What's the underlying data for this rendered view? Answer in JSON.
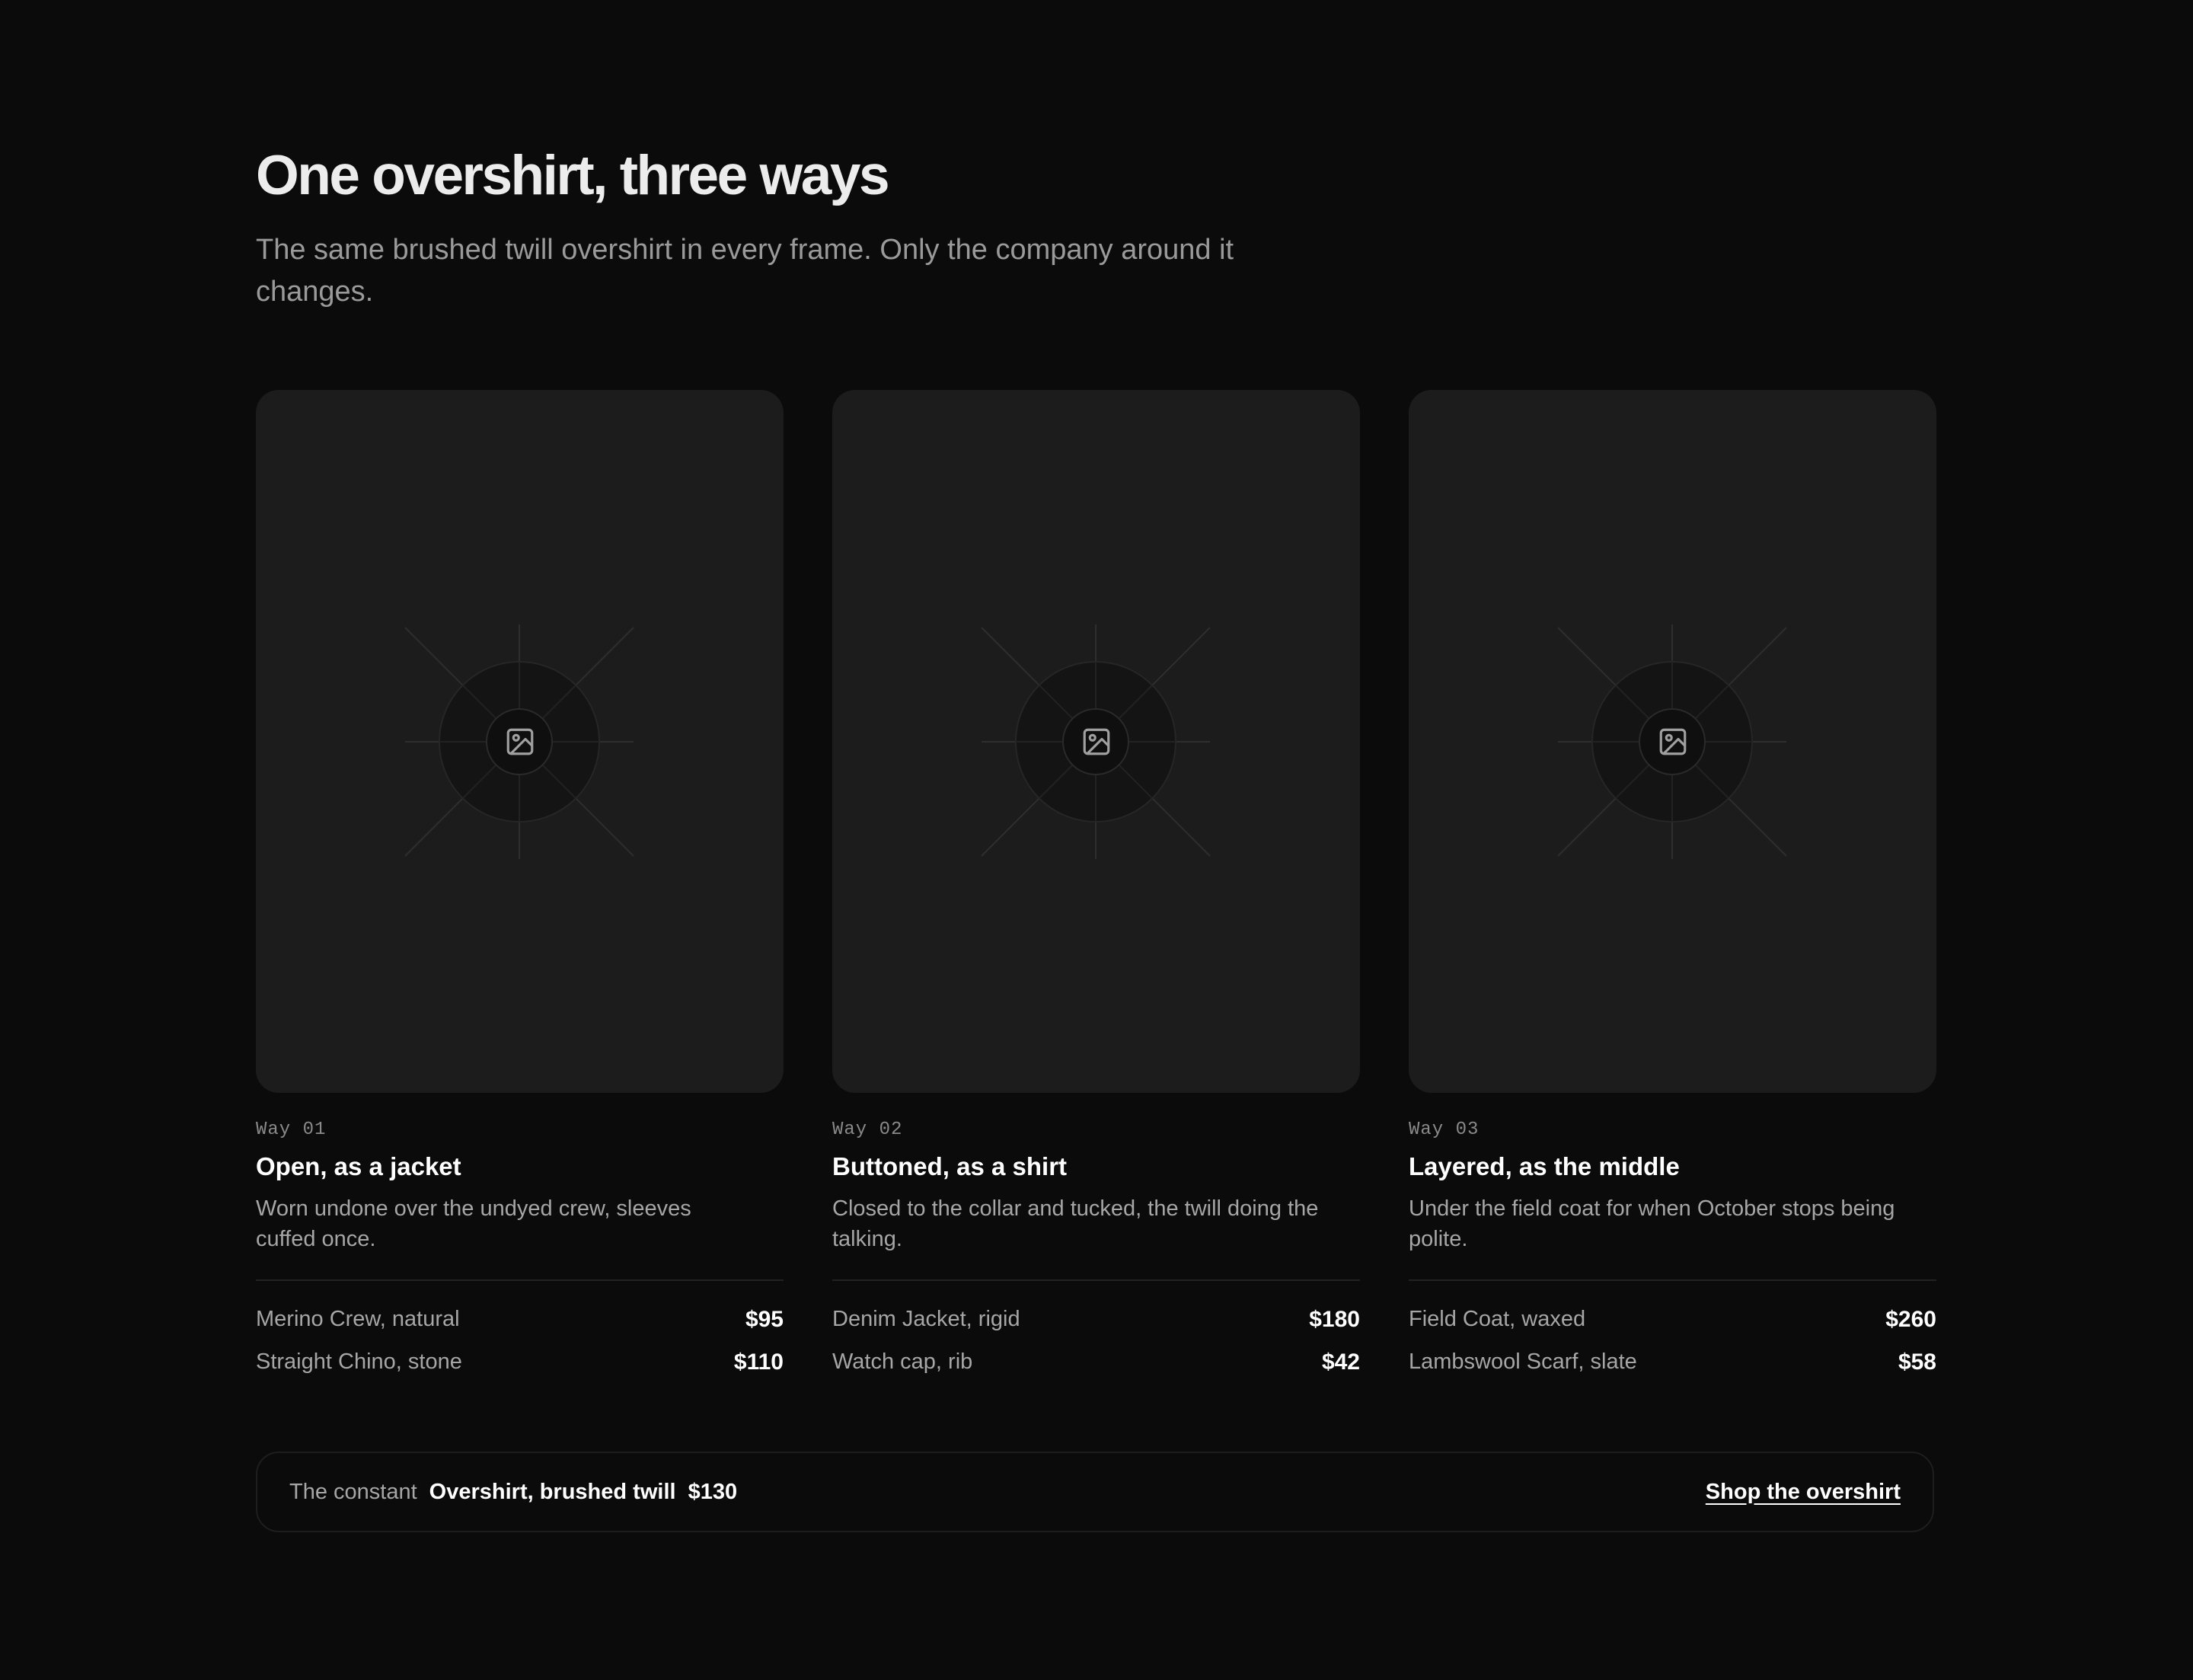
{
  "header": {
    "title": "One overshirt, three ways",
    "subtitle": "The same brushed twill overshirt in every frame. Only the company around it changes."
  },
  "cards": [
    {
      "way": "Way 01",
      "title": "Open, as a jacket",
      "description": "Worn undone over the undyed crew, sleeves cuffed once.",
      "image_icon": "image-placeholder-icon",
      "items": [
        {
          "name": "Merino Crew, natural",
          "price": "$95"
        },
        {
          "name": "Straight Chino, stone",
          "price": "$110"
        }
      ]
    },
    {
      "way": "Way 02",
      "title": "Buttoned, as a shirt",
      "description": "Closed to the collar and tucked, the twill doing the talking.",
      "image_icon": "image-placeholder-icon",
      "items": [
        {
          "name": "Denim Jacket, rigid",
          "price": "$180"
        },
        {
          "name": "Watch cap, rib",
          "price": "$42"
        }
      ]
    },
    {
      "way": "Way 03",
      "title": "Layered, as the middle",
      "description": "Under the field coat for when October stops being polite.",
      "image_icon": "image-placeholder-icon",
      "items": [
        {
          "name": "Field Coat, waxed",
          "price": "$260"
        },
        {
          "name": "Lambswool Scarf, slate",
          "price": "$58"
        }
      ]
    }
  ],
  "constant": {
    "label": "The constant",
    "name": "Overshirt, brushed twill",
    "price": "$130",
    "cta": "Shop the overshirt"
  },
  "colors": {
    "background": "#0b0b0b",
    "card": "#1c1c1c",
    "text": "#ffffff",
    "muted": "#a6a6a6"
  }
}
